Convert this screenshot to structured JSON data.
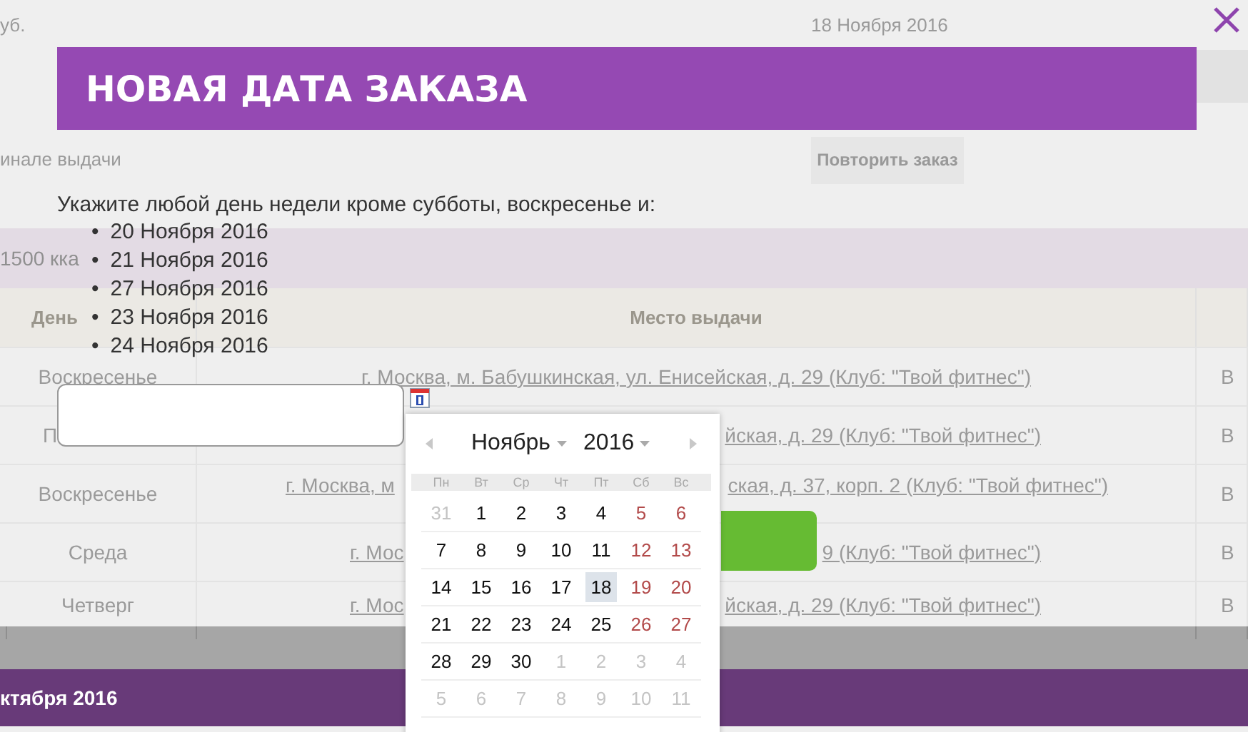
{
  "background_page": {
    "top_fragment": "уб.",
    "top_date": "18 Ноября 2016",
    "pickup_fragment": "инале выдачи",
    "repeat_button": "Повторить заказ",
    "band_fragment": "1500 кка",
    "table": {
      "columns": [
        "День",
        "Место выдачи"
      ],
      "rows": [
        {
          "day": "Воскресенье",
          "address": "г. Москва, м. Бабушкинская, ул. Енисейская, д. 29 (Клуб: \"Твой фитнес\")",
          "status": "В"
        },
        {
          "day": "П",
          "address_end": "йская, д. 29 (Клуб: \"Твой фитнес\")",
          "status": "В"
        },
        {
          "day": "Воскресенье",
          "address_start": "г. Москва, м",
          "address_end": "ская, д. 37, корп. 2 (Клуб: \"Твой фитнес\")",
          "status": "В"
        },
        {
          "day": "Среда",
          "address_start": "г. Мос",
          "address_end": "9 (Клуб: \"Твой фитнес\")",
          "status": "В"
        },
        {
          "day": "Четверг",
          "address_start": "г. Мос",
          "address_end": "йская, д. 29 (Клуб: \"Твой фитнес\")",
          "status": "В"
        }
      ]
    },
    "footer_fragment": "ктября 2016"
  },
  "modal": {
    "title": "НОВАЯ ДАТА ЗАКАЗА",
    "instruction": "Укажите любой день недели кроме субботы, воскресенье и:",
    "dates": [
      {
        "bullet": "•",
        "text": "20 Ноября 2016"
      },
      {
        "bullet": "•",
        "text": "21 Ноября 2016"
      },
      {
        "bullet": "•",
        "text": "27 Ноября 2016"
      },
      {
        "bullet": "•",
        "text": "23 Ноября 2016"
      },
      {
        "bullet": "•",
        "text": "24 Ноября 2016"
      }
    ],
    "datepicker": {
      "month": "Ноябрь",
      "year": "2016",
      "weekdays": [
        "Пн",
        "Вт",
        "Ср",
        "Чт",
        "Пт",
        "Сб",
        "Вс"
      ],
      "weeks": [
        [
          {
            "label": "31",
            "kind": "other",
            "today": false
          },
          {
            "label": "1",
            "kind": "weekday",
            "today": false
          },
          {
            "label": "2",
            "kind": "weekday",
            "today": false
          },
          {
            "label": "3",
            "kind": "weekday",
            "today": false
          },
          {
            "label": "4",
            "kind": "weekday",
            "today": false
          },
          {
            "label": "5",
            "kind": "weekend",
            "today": false
          },
          {
            "label": "6",
            "kind": "weekend",
            "today": false
          }
        ],
        [
          {
            "label": "7",
            "kind": "weekday",
            "today": false
          },
          {
            "label": "8",
            "kind": "weekday",
            "today": false
          },
          {
            "label": "9",
            "kind": "weekday",
            "today": false
          },
          {
            "label": "10",
            "kind": "weekday",
            "today": false
          },
          {
            "label": "11",
            "kind": "weekday",
            "today": false
          },
          {
            "label": "12",
            "kind": "weekend",
            "today": false
          },
          {
            "label": "13",
            "kind": "weekend",
            "today": false
          }
        ],
        [
          {
            "label": "14",
            "kind": "weekday",
            "today": false
          },
          {
            "label": "15",
            "kind": "weekday",
            "today": false
          },
          {
            "label": "16",
            "kind": "weekday",
            "today": false
          },
          {
            "label": "17",
            "kind": "weekday",
            "today": false
          },
          {
            "label": "18",
            "kind": "weekday",
            "today": true
          },
          {
            "label": "19",
            "kind": "weekend",
            "today": false
          },
          {
            "label": "20",
            "kind": "weekend",
            "today": false
          }
        ],
        [
          {
            "label": "21",
            "kind": "weekday",
            "today": false
          },
          {
            "label": "22",
            "kind": "weekday",
            "today": false
          },
          {
            "label": "23",
            "kind": "weekday",
            "today": false
          },
          {
            "label": "24",
            "kind": "weekday",
            "today": false
          },
          {
            "label": "25",
            "kind": "weekday",
            "today": false
          },
          {
            "label": "26",
            "kind": "weekend",
            "today": false
          },
          {
            "label": "27",
            "kind": "weekend",
            "today": false
          }
        ],
        [
          {
            "label": "28",
            "kind": "weekday",
            "today": false
          },
          {
            "label": "29",
            "kind": "weekday",
            "today": false
          },
          {
            "label": "30",
            "kind": "weekday",
            "today": false
          },
          {
            "label": "1",
            "kind": "other",
            "today": false
          },
          {
            "label": "2",
            "kind": "other",
            "today": false
          },
          {
            "label": "3",
            "kind": "other",
            "today": false
          },
          {
            "label": "4",
            "kind": "other",
            "today": false
          }
        ],
        [
          {
            "label": "5",
            "kind": "other",
            "today": false
          },
          {
            "label": "6",
            "kind": "other",
            "today": false
          },
          {
            "label": "7",
            "kind": "other",
            "today": false
          },
          {
            "label": "8",
            "kind": "other",
            "today": false
          },
          {
            "label": "9",
            "kind": "other",
            "today": false
          },
          {
            "label": "10",
            "kind": "other",
            "today": false
          },
          {
            "label": "11",
            "kind": "other",
            "today": false
          }
        ]
      ]
    }
  }
}
